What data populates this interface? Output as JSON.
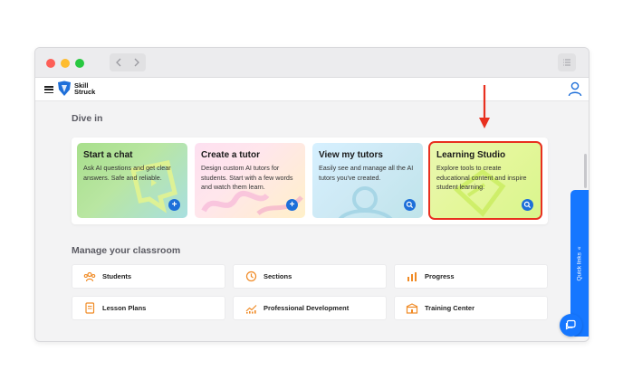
{
  "browser": {
    "back_icon": "chevron-left-icon",
    "forward_icon": "chevron-right-icon",
    "menu_icon": "list-icon"
  },
  "app": {
    "logo_line1": "Skill",
    "logo_line2": "Struck",
    "brand_color": "#1e6fd9"
  },
  "dive_in": {
    "title": "Dive in",
    "cards": [
      {
        "title": "Start a chat",
        "desc": "Ask AI questions and get clear answers. Safe and reliable.",
        "button": "+"
      },
      {
        "title": "Create a tutor",
        "desc": "Design custom AI tutors for students. Start with a few words and watch them learn.",
        "button": "+"
      },
      {
        "title": "View my tutors",
        "desc": "Easily see and manage all the AI tutors you've created.",
        "button": "search"
      },
      {
        "title": "Learning Studio",
        "desc": "Explore tools to create educational content and inspire student learning.",
        "button": "search"
      }
    ],
    "highlight_color": "#e8301f"
  },
  "classroom": {
    "title": "Manage your classroom",
    "tiles": [
      {
        "label": "Students",
        "icon": "people-icon"
      },
      {
        "label": "Sections",
        "icon": "clock-icon"
      },
      {
        "label": "Progress",
        "icon": "bar-chart-icon"
      },
      {
        "label": "Lesson Plans",
        "icon": "notebook-icon"
      },
      {
        "label": "Professional Development",
        "icon": "growth-chart-icon"
      },
      {
        "label": "Training Center",
        "icon": "building-icon"
      }
    ]
  },
  "quick_links": {
    "label": "Quick links"
  },
  "accent_color": "#1677ff"
}
